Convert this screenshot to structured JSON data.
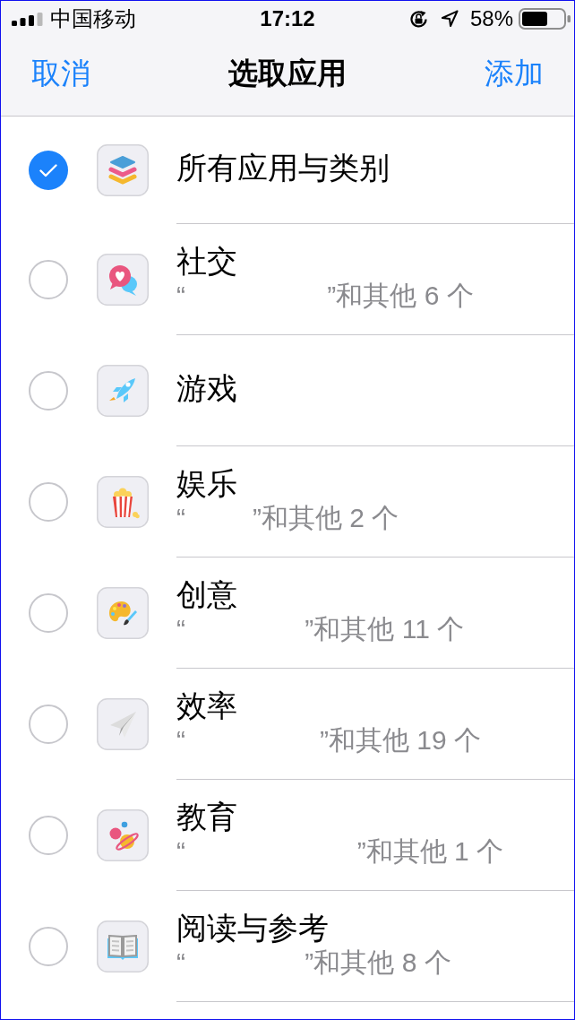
{
  "status_bar": {
    "carrier": "中国移动",
    "time": "17:12",
    "battery_percent": "58%"
  },
  "nav_bar": {
    "cancel": "取消",
    "title": "选取应用",
    "add": "添加"
  },
  "categories": [
    {
      "kind": "all",
      "title": "所有应用与类别",
      "selected": true
    },
    {
      "kind": "social",
      "title": "社交",
      "subtitle": "“                   ”和其他 6 个",
      "selected": false
    },
    {
      "kind": "games",
      "title": "游戏",
      "selected": false
    },
    {
      "kind": "entertainment",
      "title": "娱乐",
      "subtitle": "“         ”和其他 2 个",
      "selected": false
    },
    {
      "kind": "creativity",
      "title": "创意",
      "subtitle": "“                ”和其他 11 个",
      "selected": false
    },
    {
      "kind": "productivity",
      "title": "效率",
      "subtitle": "“                  ”和其他 19 个",
      "selected": false
    },
    {
      "kind": "education",
      "title": "教育",
      "subtitle": "“                       ”和其他 1 个",
      "selected": false
    },
    {
      "kind": "reading",
      "title": "阅读与参考",
      "subtitle": "“                ”和其他 8 个",
      "selected": false
    }
  ]
}
